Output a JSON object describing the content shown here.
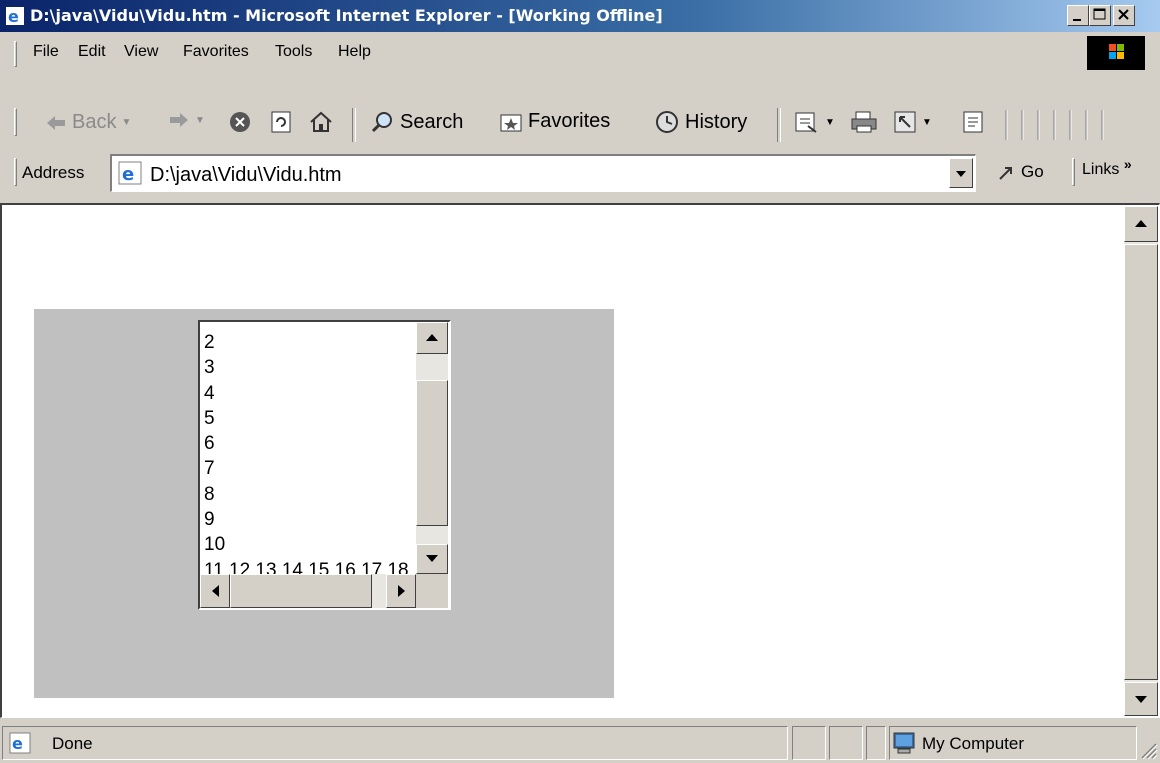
{
  "window": {
    "title": "D:\\java\\Vidu\\Vidu.htm - Microsoft Internet Explorer - [Working Offline]"
  },
  "menu": {
    "items": [
      {
        "label": "File"
      },
      {
        "label": "Edit"
      },
      {
        "label": "View"
      },
      {
        "label": "Favorites"
      },
      {
        "label": "Tools"
      },
      {
        "label": "Help"
      }
    ]
  },
  "toolbar": {
    "back": "Back",
    "search": "Search",
    "favorites": "Favorites",
    "history": "History"
  },
  "address": {
    "label": "Address",
    "value": "D:\\java\\Vidu\\Vidu.htm",
    "go": "Go",
    "links": "Links"
  },
  "listbox": {
    "items": [
      "2",
      "3",
      "4",
      "5",
      "6",
      "7",
      "8",
      "9",
      "10"
    ],
    "last_row": "11 12 13 14 15 16 17 18"
  },
  "status": {
    "text": "Done",
    "zone": "My Computer"
  }
}
